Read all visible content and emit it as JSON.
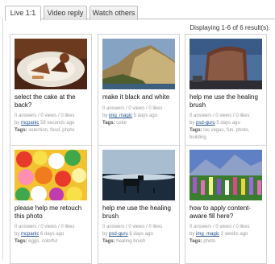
{
  "tabs": [
    {
      "label": "Live 1:1",
      "active": true
    },
    {
      "label": "Video reply",
      "active": false
    },
    {
      "label": "Watch others",
      "active": false
    }
  ],
  "results_text": "Displaying 1-6 of 6 result(s).",
  "cards": [
    {
      "title": "select the cake at the back?",
      "stats": "0 answers / 0 views / 0 likes",
      "by": "by",
      "user": "mcpanic",
      "time": "58 seconds ago",
      "tags_label": "Tags:",
      "tags": "selection, food, photo",
      "image": "cake-photo"
    },
    {
      "title": "make it black and white",
      "stats": "0 answers / 0 views / 0 likes",
      "by": "by",
      "user": "img_magic",
      "time": "5 days ago",
      "tags_label": "Tags:",
      "tags": "color",
      "image": "cliff-coast-photo"
    },
    {
      "title": "help me use the healing brush",
      "stats": "0 answers / 0 views / 0 likes",
      "by": "by",
      "user": "psd-guru",
      "time": "5 days ago",
      "tags_label": "Tags:",
      "tags": "las vegas, fun, photo, building",
      "image": "hotel-building-photo"
    },
    {
      "title": "please help me retouch this photo",
      "stats": "0 answers / 0 views / 0 likes",
      "by": "by",
      "user": "mcpanic",
      "time": "6 days ago",
      "tags_label": "Tags:",
      "tags": "eggs, colorful",
      "image": "colorful-candy-photo"
    },
    {
      "title": "help me use the healing brush",
      "stats": "0 answers / 0 views / 0 likes",
      "by": "by",
      "user": "psd-guru",
      "time": "6 days ago",
      "tags_label": "Tags:",
      "tags": "healing brush",
      "image": "moose-lake-photo"
    },
    {
      "title": "how to apply content-aware fill here?",
      "stats": "0 answers / 0 views / 0 likes",
      "by": "by",
      "user": "img_magic",
      "time": "2 weeks ago",
      "tags_label": "Tags:",
      "tags": "photo",
      "image": "flower-field-photo"
    }
  ]
}
